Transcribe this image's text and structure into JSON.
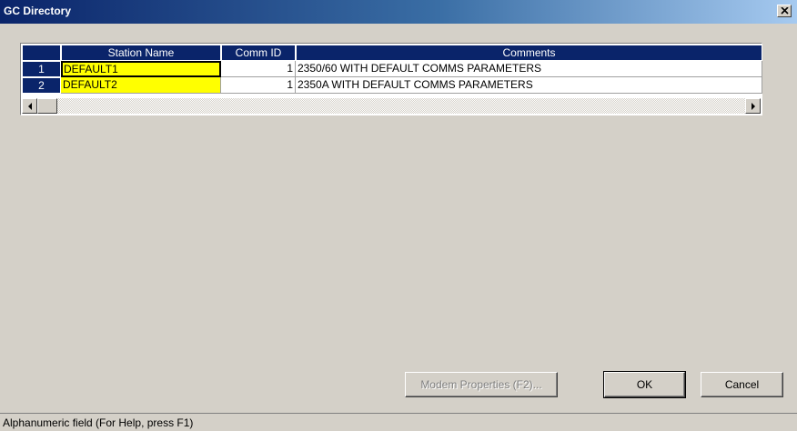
{
  "window": {
    "title": "GC Directory"
  },
  "grid": {
    "columns": [
      "Station Name",
      "Comm ID",
      "Comments"
    ],
    "rows": [
      {
        "num": "1",
        "station": "DEFAULT1",
        "comm_id": "1",
        "comment": "2350/60 WITH DEFAULT COMMS PARAMETERS"
      },
      {
        "num": "2",
        "station": "DEFAULT2",
        "comm_id": "1",
        "comment": "2350A WITH DEFAULT COMMS PARAMETERS"
      }
    ]
  },
  "buttons": {
    "modem": "Modem Properties (F2)...",
    "ok": "OK",
    "cancel": "Cancel"
  },
  "status": {
    "text": "Alphanumeric field (For Help, press F1)"
  },
  "colors": {
    "header_bg": "#0a246a",
    "station_bg": "#ffff00"
  }
}
